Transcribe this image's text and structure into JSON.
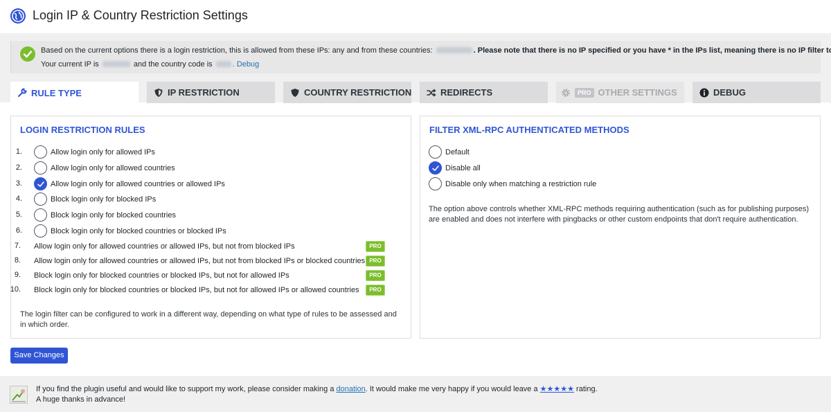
{
  "header": {
    "title": "Login IP & Country Restriction Settings"
  },
  "notice": {
    "text_prefix": "Based on the current options there is a login restriction, this is allowed from these IPs: any and from these countries:",
    "bold_text": ". Please note that there is no IP specified or you have * in the IPs list, meaning there is no IP filter to apply.",
    "ip_prefix": "Your current IP is",
    "country_prefix": "and the country code is",
    "debug_link": ". Debug"
  },
  "tabs": [
    {
      "label": "RULE TYPE",
      "icon": "wrench-icon"
    },
    {
      "label": "IP RESTRICTION",
      "icon": "shield-icon"
    },
    {
      "label": "COUNTRY RESTRICTION",
      "icon": "shield-icon"
    },
    {
      "label": "REDIRECTS",
      "icon": "shuffle-icon"
    },
    {
      "label": "OTHER SETTINGS",
      "icon": "gear-icon",
      "pro": "PRO"
    },
    {
      "label": "DEBUG",
      "icon": "info-icon"
    }
  ],
  "rules": {
    "title": "LOGIN RESTRICTION RULES",
    "items": [
      {
        "num": "1.",
        "label": "Allow login only for allowed IPs",
        "checked": false
      },
      {
        "num": "2.",
        "label": "Allow login only for allowed countries",
        "checked": false
      },
      {
        "num": "3.",
        "label": "Allow login only for allowed countries or allowed IPs",
        "checked": true
      },
      {
        "num": "4.",
        "label": "Block login only for blocked IPs",
        "checked": false
      },
      {
        "num": "5.",
        "label": "Block login only for blocked countries",
        "checked": false
      },
      {
        "num": "6.",
        "label": "Block login only for blocked countries or blocked IPs",
        "checked": false
      }
    ],
    "pro_items": [
      {
        "num": "7.",
        "label": "Allow login only for allowed countries or allowed IPs, but not from blocked IPs",
        "badge": "PRO"
      },
      {
        "num": "8.",
        "label": "Allow login only for allowed countries or allowed IPs, but not from blocked IPs or blocked countries",
        "badge": "PRO"
      },
      {
        "num": "9.",
        "label": "Block login only for blocked countries or blocked IPs, but not for allowed IPs",
        "badge": "PRO"
      },
      {
        "num": "10.",
        "label": "Block login only for blocked countries or blocked IPs, but not for allowed IPs or allowed countries",
        "badge": "PRO"
      }
    ],
    "description": "The login filter can be configured to work in a different way, depending on what type of rules to be assessed and in which order."
  },
  "xmlrpc": {
    "title": "FILTER XML-RPC AUTHENTICATED METHODS",
    "options": [
      {
        "label": "Default",
        "checked": false
      },
      {
        "label": "Disable all",
        "checked": true
      },
      {
        "label": "Disable only when matching a restriction rule",
        "checked": false
      }
    ],
    "description": "The option above controls whether XML-RPC methods requiring authentication (such as for publishing purposes) are enabled and does not interfere with pingbacks or other custom endpoints that don't require authentication."
  },
  "save_label": "Save Changes",
  "footer": {
    "text1": "If you find the plugin useful and would like to support my work, please consider making a",
    "donation_link": "donation",
    "text2": ". It would make me very happy if you would leave a",
    "stars": "★★★★★",
    "text3": "rating.",
    "line2": "A huge thanks in advance!"
  },
  "colors": {
    "accent": "#2f55d4",
    "pro": "#7cbd2d",
    "success": "#7cbd2d"
  }
}
